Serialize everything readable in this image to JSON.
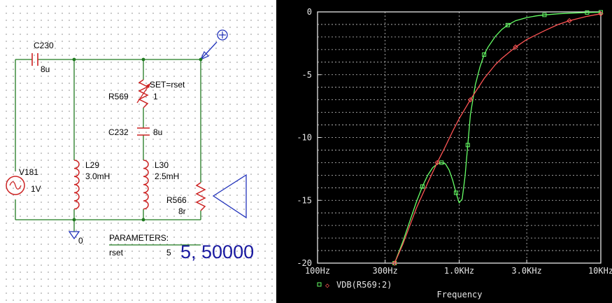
{
  "schematic": {
    "components": {
      "c230": {
        "name": "C230",
        "value": "8u"
      },
      "r569": {
        "name": "R569",
        "value": "1",
        "set": "SET=rset"
      },
      "c232": {
        "name": "C232",
        "value": "8u"
      },
      "l29": {
        "name": "L29",
        "value": "3.0mH"
      },
      "l30": {
        "name": "L30",
        "value": "2.5mH"
      },
      "v181": {
        "name": "V181",
        "value": "1V"
      },
      "r566": {
        "name": "R566",
        "value": "8r"
      }
    },
    "ground_label": "0",
    "parameters": {
      "title": "PARAMETERS:",
      "name": "rset",
      "value": "5",
      "sweep": "5, 50000"
    }
  },
  "plot": {
    "xlabel": "Frequency",
    "legend_label": "VDB(R569:2)",
    "colors": {
      "background": "#000000",
      "grid": "#c8c8c8",
      "green": "#66ff66",
      "red": "#ff5555",
      "text": "#e6e6e6"
    }
  },
  "chart_data": {
    "type": "line",
    "xscale": "log",
    "xlim": [
      100,
      10000
    ],
    "ylim": [
      -20,
      0
    ],
    "xticks": [
      100,
      300,
      1000,
      3000,
      10000
    ],
    "xtick_labels": [
      "100Hz",
      "300Hz",
      "1.0KHz",
      "3.0KHz",
      "10KHz"
    ],
    "yticks": [
      0,
      -5,
      -10,
      -15,
      -20
    ],
    "ytick_labels": [
      "0",
      "-5",
      "-10",
      "-15",
      "-20"
    ],
    "grid": true,
    "legend_position": "bottom-left",
    "series": [
      {
        "color": "green",
        "marker": "square",
        "x": [
          350,
          400,
          450,
          500,
          550,
          600,
          650,
          700,
          750,
          800,
          850,
          900,
          950,
          1000,
          1050,
          1100,
          1150,
          1200,
          1300,
          1400,
          1500,
          1600,
          1800,
          2000,
          2200,
          2500,
          3000,
          3500,
          4000,
          5000,
          6000,
          7000,
          8000,
          10000
        ],
        "y": [
          -20,
          -18.3,
          -16.6,
          -15.1,
          -13.9,
          -13,
          -12.4,
          -12.1,
          -12,
          -12.1,
          -12.6,
          -13.4,
          -14.4,
          -15.2,
          -14.9,
          -13.1,
          -10.6,
          -8.2,
          -5.8,
          -4.4,
          -3.4,
          -2.8,
          -1.95,
          -1.4,
          -1.05,
          -0.7,
          -0.45,
          -0.32,
          -0.24,
          -0.15,
          -0.1,
          -0.07,
          -0.05,
          -0.03
        ]
      },
      {
        "color": "red",
        "marker": "diamond",
        "x": [
          350,
          400,
          500,
          600,
          700,
          800,
          900,
          1000,
          1200,
          1500,
          1800,
          2000,
          2500,
          3000,
          4000,
          5000,
          6000,
          8000,
          10000
        ],
        "y": [
          -20,
          -18.5,
          -15.6,
          -13.6,
          -12,
          -10.7,
          -9.5,
          -8.5,
          -7,
          -5.3,
          -4.2,
          -3.7,
          -2.8,
          -2.2,
          -1.5,
          -1,
          -0.7,
          -0.35,
          -0.15
        ]
      }
    ]
  }
}
